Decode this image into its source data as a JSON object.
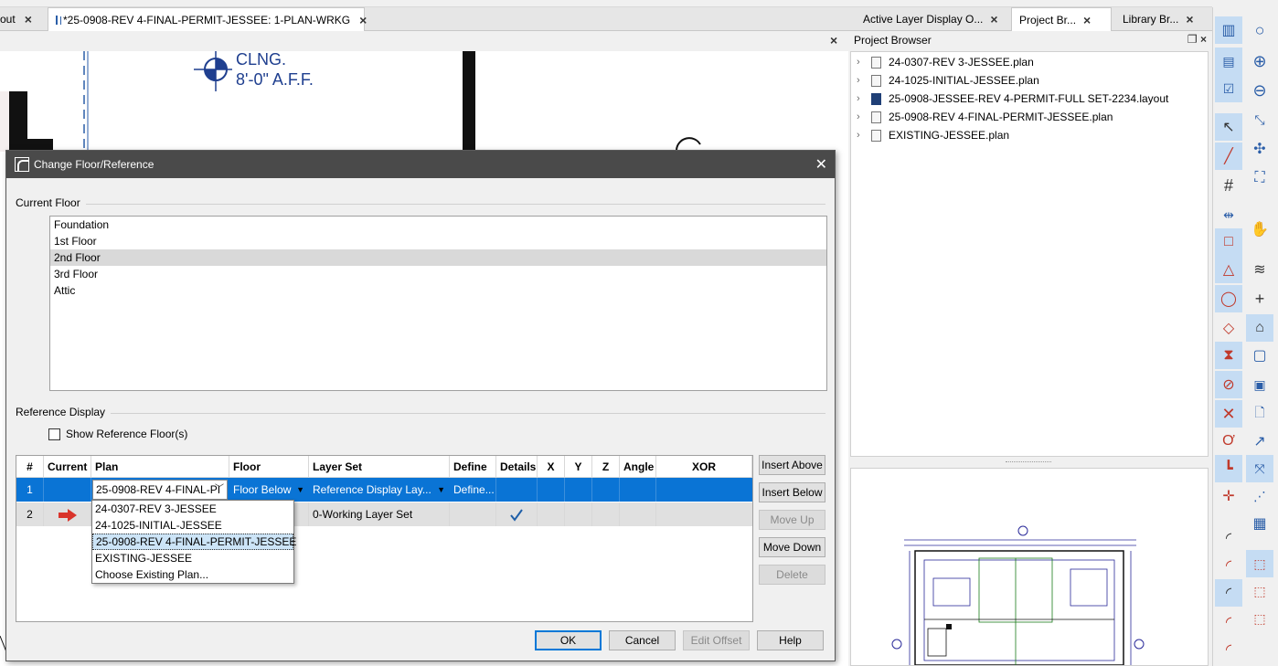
{
  "doc_tabs": {
    "layout_tab": "out",
    "plan_tab": "*25-0908-REV 4-FINAL-PERMIT-JESSEE: 1-PLAN-WRKG"
  },
  "canvas": {
    "ceiling_label_1": "CLNG.",
    "ceiling_label_2": "8'-0\" A.F.F."
  },
  "right_panel": {
    "tabs": [
      "Active Layer Display O...",
      "Project Br...",
      "Library Br..."
    ],
    "title": "Project Browser",
    "items": [
      {
        "name": "24-0307-REV 3-JESSEE.plan",
        "type": "plan"
      },
      {
        "name": "24-1025-INITIAL-JESSEE.plan",
        "type": "plan"
      },
      {
        "name": "25-0908-JESSEE-REV 4-PERMIT-FULL SET-2234.layout",
        "type": "layout"
      },
      {
        "name": "25-0908-REV 4-FINAL-PERMIT-JESSEE.plan",
        "type": "plan"
      },
      {
        "name": "EXISTING-JESSEE.plan",
        "type": "plan"
      }
    ]
  },
  "dialog": {
    "title": "Change Floor/Reference",
    "current_floor_label": "Current Floor",
    "floors": [
      "Foundation",
      "1st Floor",
      "2nd Floor",
      "3rd Floor",
      "Attic"
    ],
    "selected_floor": "2nd Floor",
    "reference_display_label": "Reference Display",
    "show_reference_label": "Show Reference Floor(s)",
    "show_reference_checked": false,
    "columns": [
      "#",
      "Current",
      "Plan",
      "Floor",
      "Layer Set",
      "Define",
      "Details",
      "X",
      "Y",
      "Z",
      "Angle",
      "XOR"
    ],
    "rows": [
      {
        "num": "1",
        "plan": "25-0908-REV 4-FINAL-PI",
        "floor": "Floor Below",
        "layer_set": "Reference Display Lay...",
        "define": "Define..."
      },
      {
        "num": "2",
        "current_marker": "arrow",
        "layer_set": "0-Working Layer Set",
        "details": "checked"
      }
    ],
    "plan_options": [
      "24-0307-REV 3-JESSEE",
      "24-1025-INITIAL-JESSEE",
      "25-0908-REV 4-FINAL-PERMIT-JESSEE",
      "EXISTING-JESSEE",
      "Choose Existing Plan..."
    ],
    "plan_selected": "25-0908-REV 4-FINAL-PERMIT-JESSEE",
    "side_buttons": {
      "insert_above": "Insert Above",
      "insert_below": "Insert Below",
      "move_up": "Move Up",
      "move_down": "Move Down",
      "delete": "Delete"
    },
    "footer_buttons": {
      "ok": "OK",
      "cancel": "Cancel",
      "edit_offset": "Edit Offset",
      "help": "Help"
    }
  },
  "colors": {
    "selection_blue": "#0a74d5",
    "title_bar": "#4a4a4a",
    "arrow_red": "#d9342b",
    "check_blue": "#1f5fa8"
  }
}
